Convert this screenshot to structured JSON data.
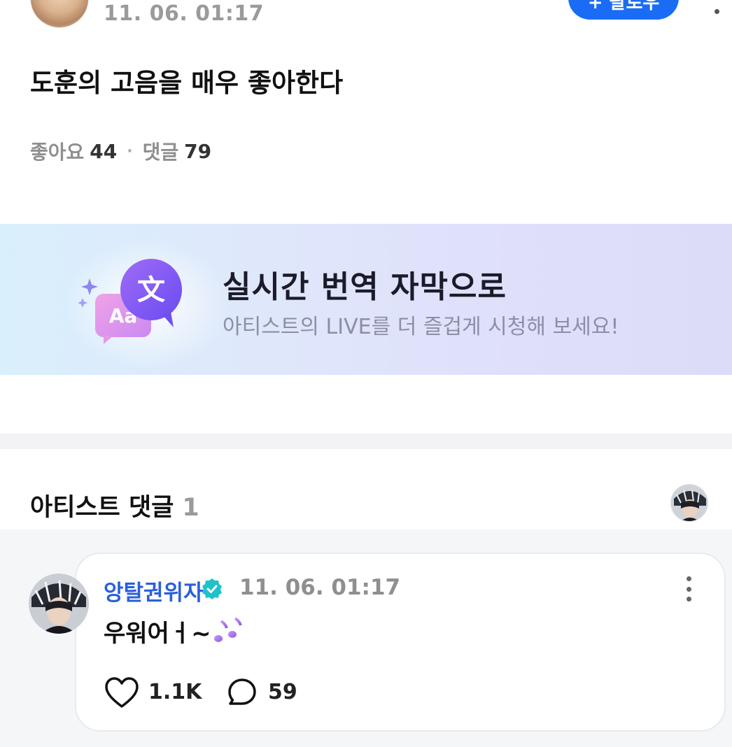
{
  "post": {
    "time": "11. 06. 01:17",
    "follow_label": "+ 팔로우",
    "text": "도훈의 고음을 매우 좋아한다",
    "likes_label": "좋아요",
    "likes_count": "44",
    "separator": "·",
    "comments_label": "댓글",
    "comments_count": "79"
  },
  "banner": {
    "title": "실시간 번역 자막으로",
    "subtitle": "아티스트의 LIVE를 더 즐겁게 시청해 보세요!",
    "icon_glyph_back": "Aa",
    "icon_glyph_front": "文",
    "icon": "translate-bubbles-icon"
  },
  "artist_comments": {
    "title": "아티스트 댓글",
    "count": "1",
    "comment": {
      "author": "앙탈권위자",
      "time": "11. 06. 01:17",
      "text": "우워어ㅓ~",
      "emoji": "musical-notes-emoji",
      "like_count": "1.1K",
      "reply_count": "59"
    }
  },
  "colors": {
    "accent_blue": "#1a6cf5",
    "author_blue": "#2b5fd9",
    "verified_teal": "#1fc2c9"
  }
}
